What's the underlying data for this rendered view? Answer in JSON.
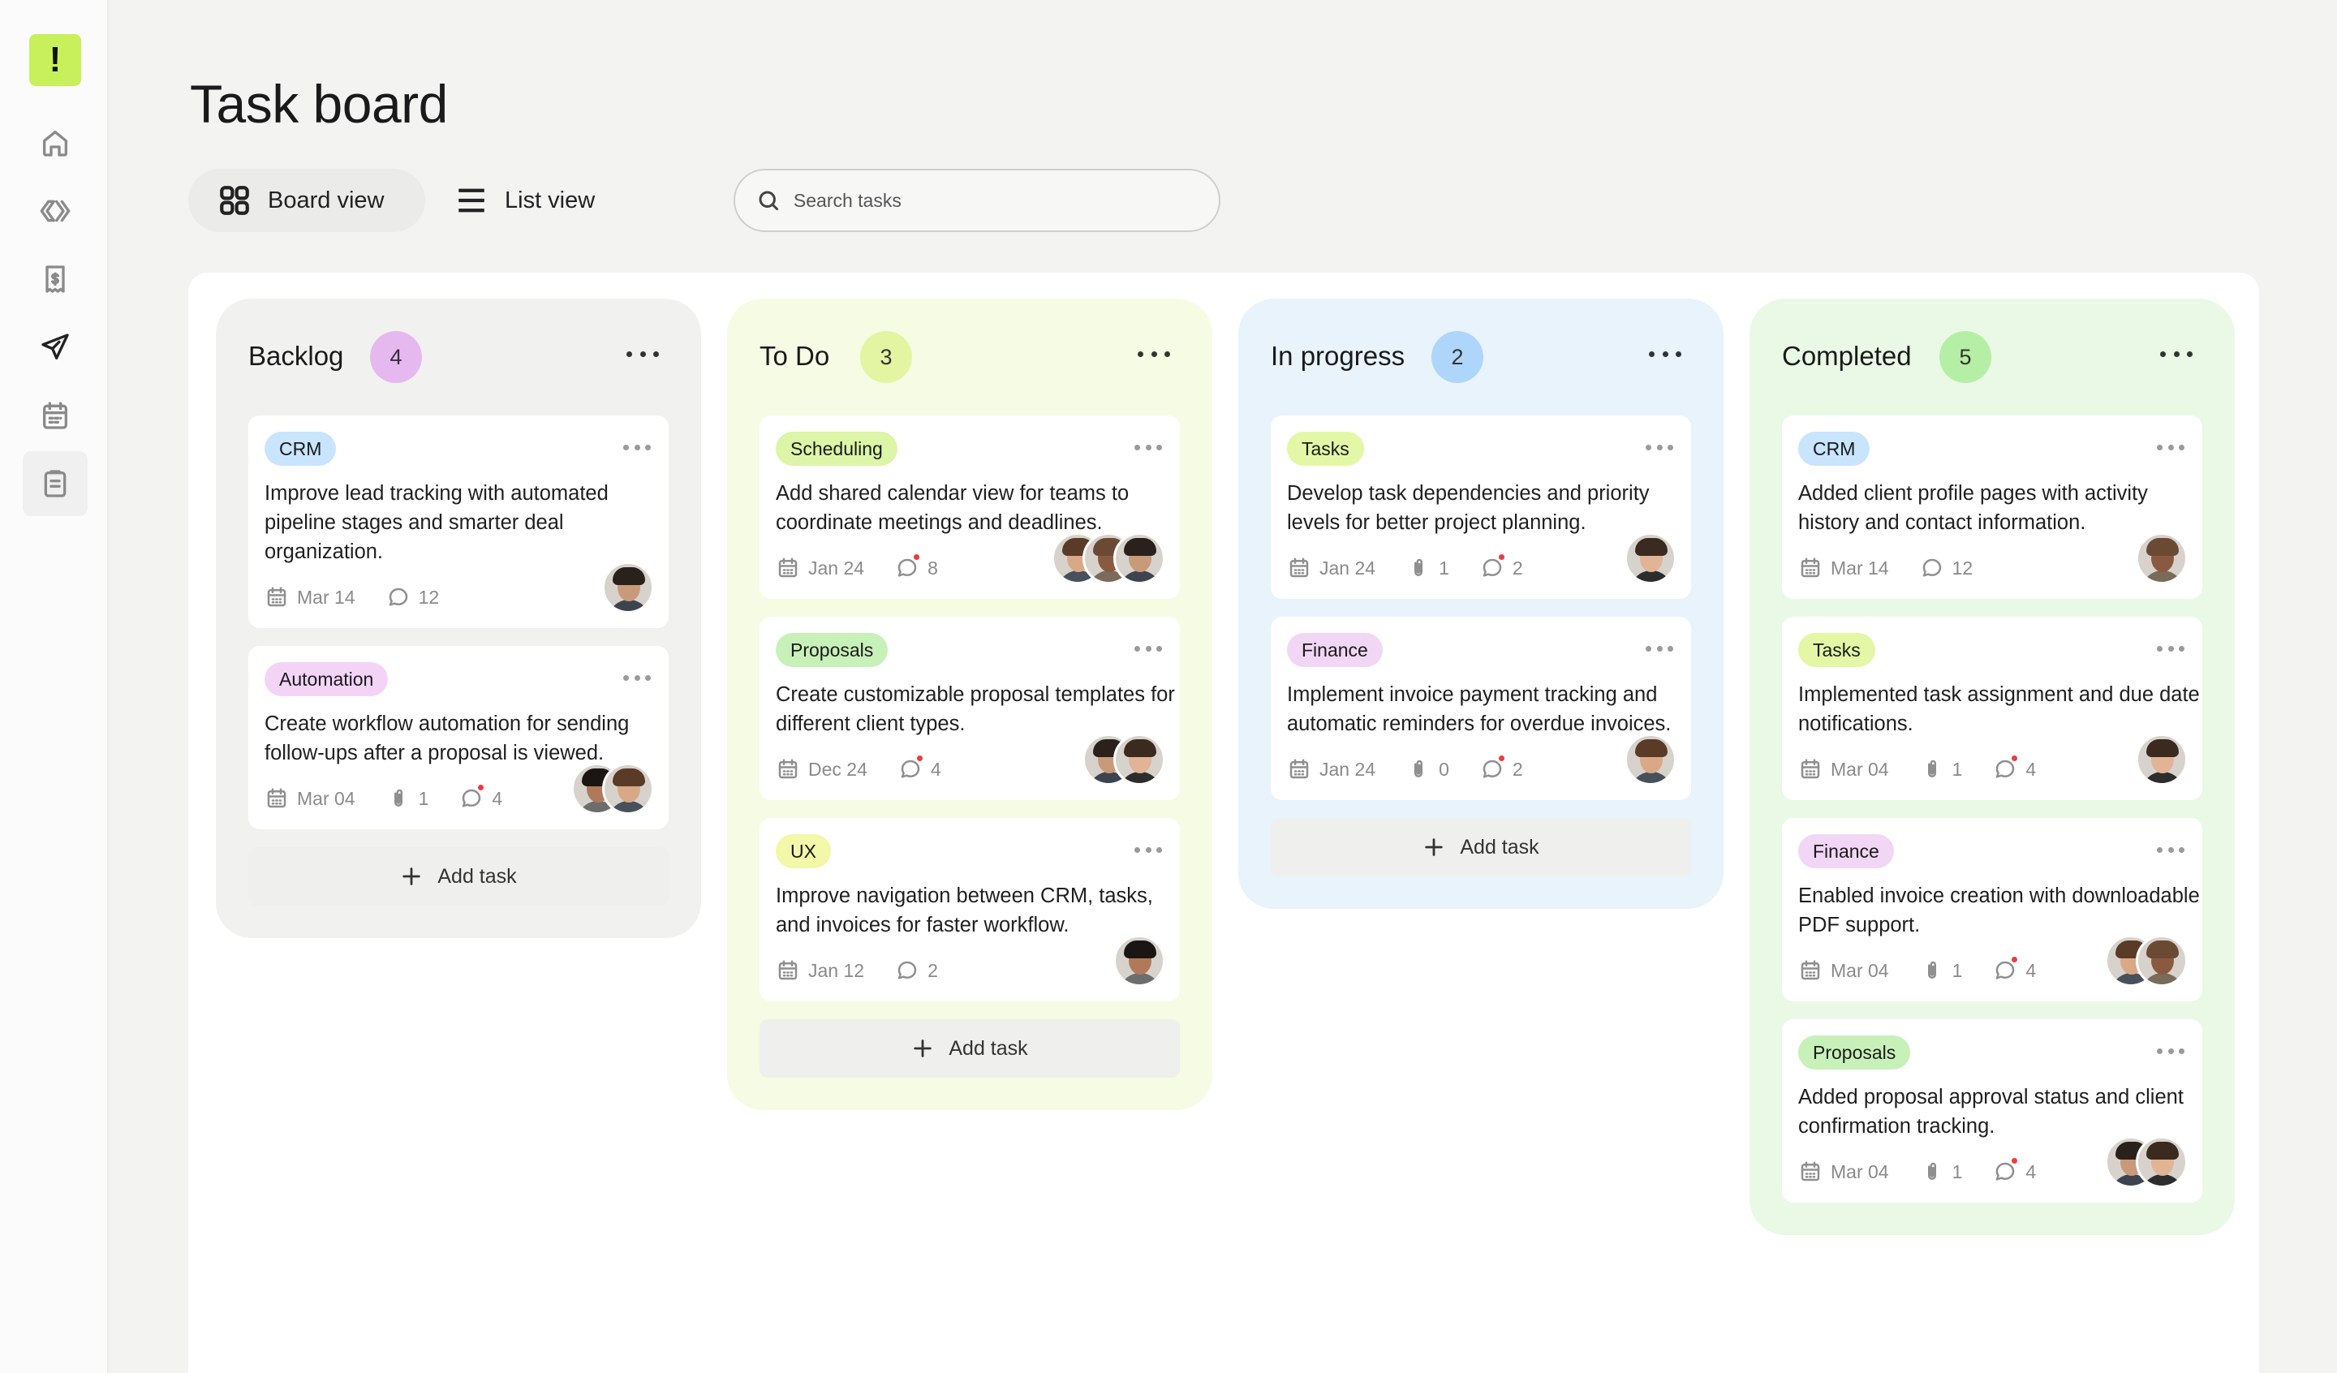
{
  "app": {
    "logo_glyph": "!",
    "title": "Task board"
  },
  "sidebar": {
    "items": [
      {
        "name": "home",
        "icon": "home-icon",
        "active": false
      },
      {
        "name": "pipeline",
        "icon": "chevrons-icon",
        "active": false
      },
      {
        "name": "invoices",
        "icon": "receipt-icon",
        "active": false
      },
      {
        "name": "proposals",
        "icon": "send-icon",
        "active": false
      },
      {
        "name": "calendar",
        "icon": "calendar-icon",
        "active": false
      },
      {
        "name": "tasks",
        "icon": "clipboard-icon",
        "active": true
      }
    ]
  },
  "views": {
    "board_label": "Board view",
    "list_label": "List view",
    "active": "board"
  },
  "search": {
    "placeholder": "Search tasks",
    "value": ""
  },
  "colors": {
    "crm": "#c9e4fd",
    "automation": "#f3d4f7",
    "scheduling": "#dcf5a6",
    "proposals": "#c7f1b9",
    "ux": "#f3f7a8",
    "tasks": "#e3f7a6",
    "finance": "#f2d6f5"
  },
  "columns": [
    {
      "title": "Backlog",
      "count": "4",
      "bg": "#f1f1ef",
      "count_bg": "#e6b8f0",
      "cards": [
        {
          "tag": "CRM",
          "tag_color": "#c9e4fd",
          "text": "Improve lead tracking with automated pipeline stages and smarter deal organization.",
          "date": "Mar 14",
          "attachments": null,
          "comments": "12",
          "unread": false,
          "avatars": 1
        },
        {
          "tag": "Automation",
          "tag_color": "#f3d4f7",
          "text": "Create workflow automation for sending follow-ups after a proposal is viewed.",
          "date": "Mar 04",
          "attachments": "1",
          "comments": "4",
          "unread": true,
          "avatars": 2
        }
      ],
      "add_label": "Add task"
    },
    {
      "title": "To Do",
      "count": "3",
      "bg": "#f6fbe4",
      "count_bg": "#e4f5a2",
      "cards": [
        {
          "tag": "Scheduling",
          "tag_color": "#dcf5a6",
          "text": "Add shared calendar view for teams to coordinate meetings and deadlines.",
          "date": "Jan 24",
          "attachments": null,
          "comments": "8",
          "unread": true,
          "avatars": 3
        },
        {
          "tag": "Proposals",
          "tag_color": "#c7f1b9",
          "text": "Create customizable proposal templates for different client types.",
          "date": "Dec 24",
          "attachments": null,
          "comments": "4",
          "unread": true,
          "avatars": 2
        },
        {
          "tag": "UX",
          "tag_color": "#f3f7a8",
          "text": "Improve navigation between CRM, tasks, and invoices for faster workflow.",
          "date": "Jan 12",
          "attachments": null,
          "comments": "2",
          "unread": false,
          "avatars": 1
        }
      ],
      "add_label": "Add task"
    },
    {
      "title": "In progress",
      "count": "2",
      "bg": "#e8f3fc",
      "count_bg": "#aed6fa",
      "cards": [
        {
          "tag": "Tasks",
          "tag_color": "#e3f7a6",
          "text": "Develop task dependencies and priority levels for better project planning.",
          "date": "Jan 24",
          "attachments": "1",
          "comments": "2",
          "unread": true,
          "avatars": 1
        },
        {
          "tag": "Finance",
          "tag_color": "#f2d6f5",
          "text": "Implement invoice payment tracking and automatic reminders for overdue invoices.",
          "date": "Jan 24",
          "attachments": "0",
          "comments": "2",
          "unread": true,
          "avatars": 1
        }
      ],
      "add_label": "Add task"
    },
    {
      "title": "Completed",
      "count": "5",
      "bg": "#e9f9e6",
      "count_bg": "#b5efa6",
      "cards": [
        {
          "tag": "CRM",
          "tag_color": "#c9e4fd",
          "text": "Added client profile pages with activity history and contact information.",
          "date": "Mar 14",
          "attachments": null,
          "comments": "12",
          "unread": false,
          "avatars": 1
        },
        {
          "tag": "Tasks",
          "tag_color": "#e3f7a6",
          "text": "Implemented task assignment and due date notifications.",
          "date": "Mar 04",
          "attachments": "1",
          "comments": "4",
          "unread": true,
          "avatars": 1
        },
        {
          "tag": "Finance",
          "tag_color": "#f2d6f5",
          "text": "Enabled invoice creation with downloadable PDF support.",
          "date": "Mar 04",
          "attachments": "1",
          "comments": "4",
          "unread": true,
          "avatars": 2
        },
        {
          "tag": "Proposals",
          "tag_color": "#c7f1b9",
          "text": "Added proposal approval status and client confirmation tracking.",
          "date": "Mar 04",
          "attachments": "1",
          "comments": "4",
          "unread": true,
          "avatars": 2
        }
      ],
      "add_label": null
    }
  ]
}
